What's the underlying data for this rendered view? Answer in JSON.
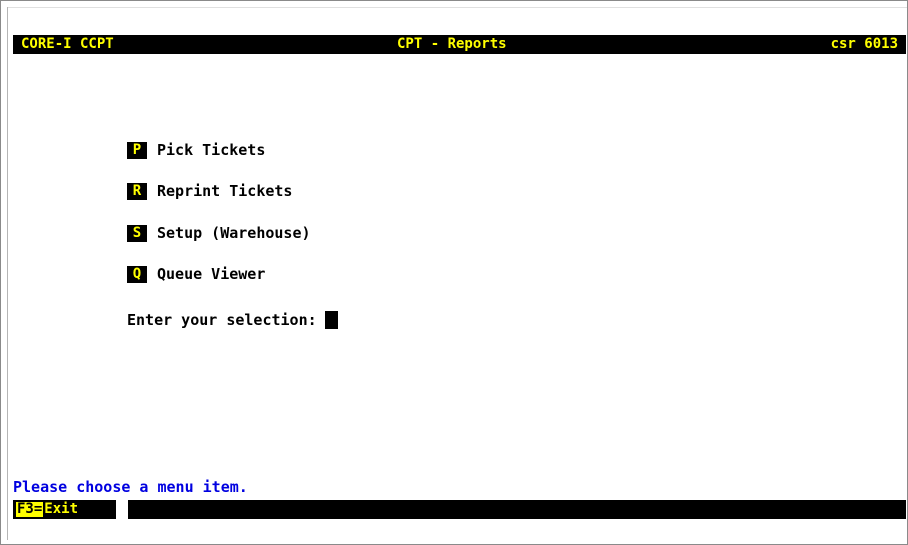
{
  "header": {
    "left": "CORE-I CCPT",
    "title": "CPT - Reports",
    "right": "csr 6013"
  },
  "menu": {
    "items": [
      {
        "key": "P",
        "label": "Pick Tickets"
      },
      {
        "key": "R",
        "label": "Reprint Tickets"
      },
      {
        "key": "S",
        "label": "Setup (Warehouse)"
      },
      {
        "key": "Q",
        "label": "Queue Viewer"
      }
    ],
    "prompt": "Enter your selection:"
  },
  "status": {
    "message": "Please choose a menu item."
  },
  "function_keys": [
    {
      "key": "F3=",
      "label": "Exit"
    }
  ],
  "colors": {
    "background": "#ffffff",
    "bar": "#000000",
    "highlight": "#ffff00",
    "message": "#0000e0"
  }
}
